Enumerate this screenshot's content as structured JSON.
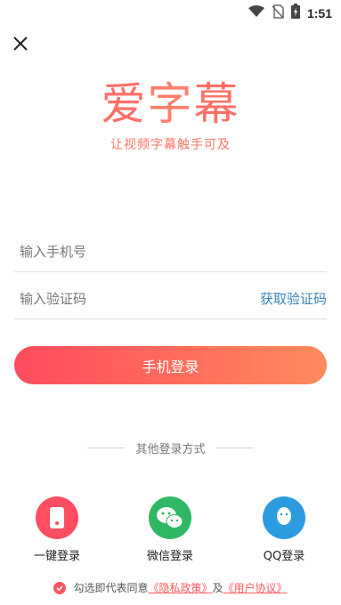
{
  "status_bar": {
    "time": "1:51",
    "icons": [
      "wifi-icon",
      "no-sim-icon",
      "battery-charging-icon"
    ]
  },
  "header": {
    "close_icon": "close-icon"
  },
  "brand": {
    "logo_chars": [
      "爱",
      "字",
      "幕"
    ],
    "slogan": "让视频字幕触手可及"
  },
  "form": {
    "phone_placeholder": "输入手机号",
    "phone_value": "",
    "code_placeholder": "输入验证码",
    "code_value": "",
    "get_code_label": "获取验证码",
    "login_label": "手机登录"
  },
  "other_login": {
    "divider_text": "其他登录方式",
    "methods": [
      {
        "label": "一键登录",
        "icon": "phone-icon"
      },
      {
        "label": "微信登录",
        "icon": "wechat-icon"
      },
      {
        "label": "QQ登录",
        "icon": "qq-icon"
      }
    ]
  },
  "agreement": {
    "prefix": "勾选即代表同意",
    "privacy": "《隐私政策》",
    "conj": "及",
    "terms": "《用户协议》"
  },
  "colors": {
    "accent": "#ff5a5f",
    "link": "#3c86b8",
    "wechat": "#2fb763",
    "qq": "#2d9be0"
  }
}
